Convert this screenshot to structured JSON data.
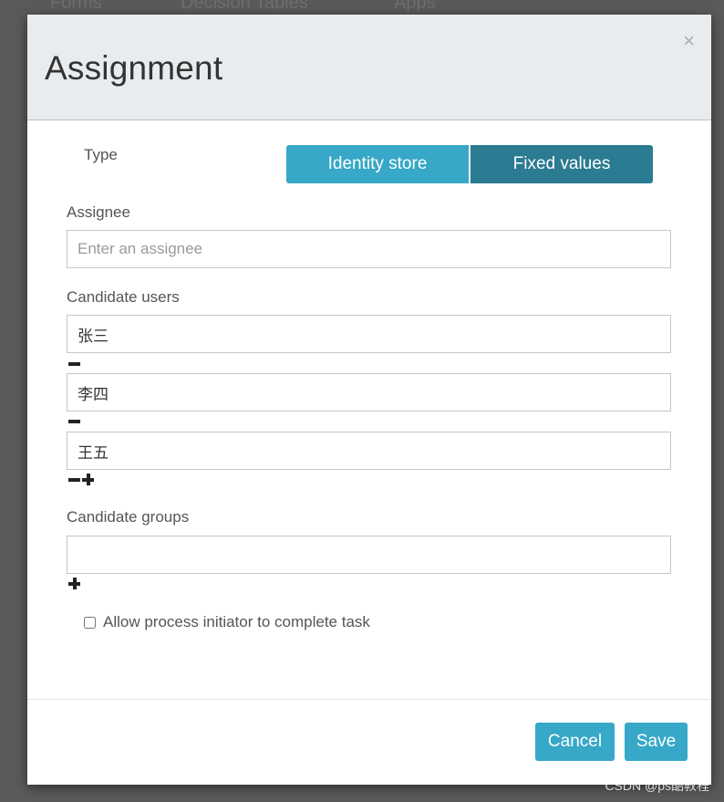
{
  "background": {
    "nav_items": [
      "Forms",
      "Decision Tables",
      "Apps"
    ]
  },
  "dialog": {
    "title": "Assignment",
    "close_glyph": "×",
    "type": {
      "label": "Type",
      "options": [
        "Identity store",
        "Fixed values"
      ],
      "selected": "Fixed values"
    },
    "assignee": {
      "label": "Assignee",
      "value": "",
      "placeholder": "Enter an assignee"
    },
    "candidate_users": {
      "label": "Candidate users",
      "values": [
        "张三",
        "李四",
        "王五"
      ]
    },
    "candidate_groups": {
      "label": "Candidate groups",
      "values": [
        ""
      ]
    },
    "allow_initiator": {
      "label": "Allow process initiator to complete task",
      "checked": false
    },
    "buttons": {
      "cancel": "Cancel",
      "save": "Save"
    }
  },
  "watermark": "CSDN @ps酷教程",
  "colors": {
    "primary": "#37a8c7",
    "primary_active": "#2b7b92",
    "header_bg": "#e8ecef"
  },
  "icons": {
    "close": "close-icon",
    "remove": "minus-icon",
    "add": "plus-icon"
  }
}
